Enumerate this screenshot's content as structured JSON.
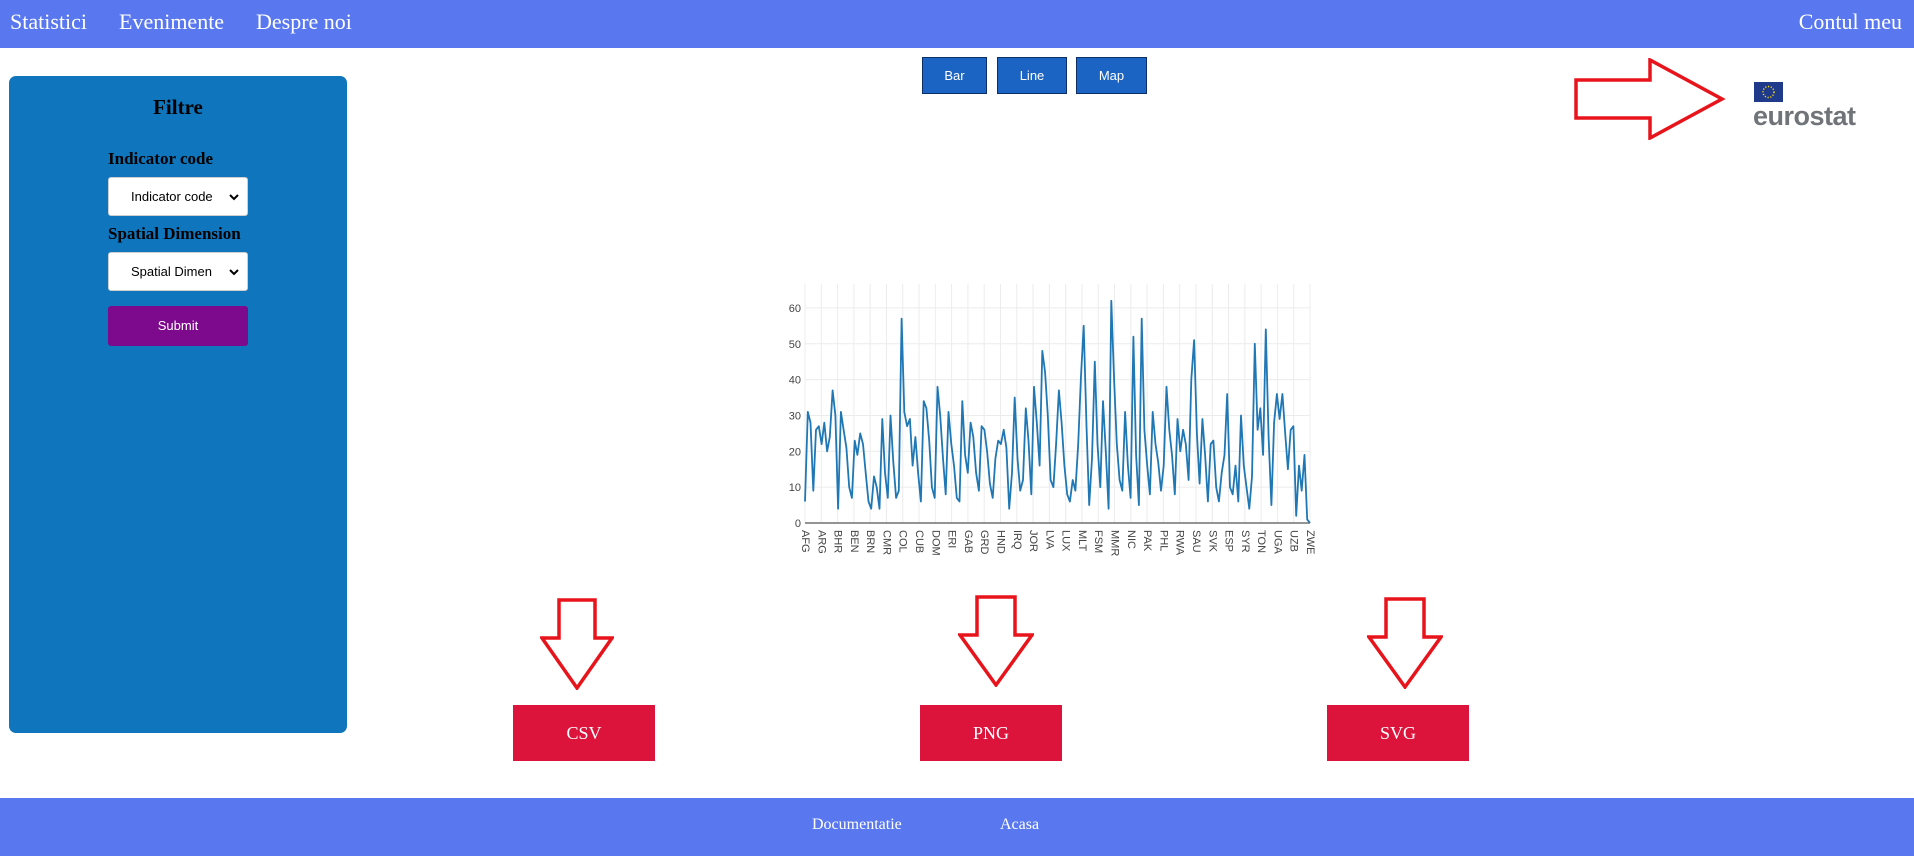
{
  "nav": {
    "left": [
      "Statistici",
      "Evenimente",
      "Despre noi"
    ],
    "right": "Contul meu"
  },
  "sidebar": {
    "title": "Filtre",
    "indicator_label": "Indicator code",
    "indicator_value": "Indicator code",
    "spatial_label": "Spatial Dimension",
    "spatial_value": "Spatial Dimen",
    "submit_label": "Submit"
  },
  "chart_types": [
    "Bar",
    "Line",
    "Map"
  ],
  "logo": {
    "text": "eurostat",
    "flag_color": "#1f3a8a",
    "star_color": "#ffdd00"
  },
  "downloads": [
    "CSV",
    "PNG",
    "SVG"
  ],
  "footer": {
    "links": [
      "Documentatie",
      "Acasa"
    ]
  },
  "colors": {
    "nav": "#5977ee",
    "sidebar": "#0f75bd",
    "submit": "#7d0a8c",
    "chart_button": "#1b64c4",
    "download": "#dc143c",
    "arrow": "#e8141c",
    "line": "#1f77b4"
  },
  "chart_data": {
    "type": "line",
    "ylim": [
      0,
      65
    ],
    "yticks": [
      0,
      10,
      20,
      30,
      40,
      50,
      60
    ],
    "xticks": [
      "AFG",
      "ARG",
      "BHR",
      "BEN",
      "BRN",
      "CMR",
      "COL",
      "CUB",
      "DOM",
      "ERI",
      "GAB",
      "GRD",
      "HND",
      "IRQ",
      "JOR",
      "LVA",
      "LUX",
      "MLT",
      "FSM",
      "MMR",
      "NIC",
      "PAK",
      "PHL",
      "RWA",
      "SAU",
      "SVK",
      "ESP",
      "SYR",
      "TON",
      "UGA",
      "UZB",
      "ZWE"
    ],
    "values": [
      6,
      31,
      28,
      9,
      26,
      27,
      22,
      28,
      20,
      24,
      37,
      30,
      4,
      31,
      26,
      21,
      10,
      7,
      23,
      19,
      25,
      22,
      14,
      6,
      4,
      13,
      10,
      4,
      29,
      14,
      7,
      30,
      17,
      7,
      9,
      57,
      31,
      27,
      29,
      16,
      24,
      14,
      6,
      34,
      32,
      23,
      10,
      7,
      38,
      30,
      18,
      8,
      31,
      22,
      16,
      7,
      6,
      34,
      19,
      14,
      28,
      24,
      14,
      9,
      27,
      26,
      20,
      11,
      7,
      18,
      23,
      22,
      26,
      21,
      4,
      14,
      35,
      18,
      9,
      12,
      32,
      23,
      8,
      38,
      28,
      16,
      48,
      42,
      30,
      12,
      10,
      22,
      37,
      28,
      16,
      8,
      6,
      12,
      9,
      22,
      41,
      55,
      27,
      5,
      18,
      45,
      22,
      10,
      34,
      20,
      4,
      62,
      40,
      22,
      12,
      9,
      31,
      16,
      7,
      52,
      19,
      5,
      57,
      26,
      16,
      8,
      31,
      22,
      17,
      9,
      16,
      38,
      26,
      19,
      8,
      29,
      20,
      26,
      22,
      12,
      40,
      51,
      25,
      11,
      29,
      19,
      6,
      22,
      23,
      10,
      6,
      14,
      19,
      36,
      10,
      8,
      16,
      6,
      30,
      16,
      10,
      4,
      13,
      50,
      26,
      32,
      19,
      54,
      24,
      5,
      28,
      36,
      29,
      36,
      25,
      15,
      26,
      27,
      2,
      16,
      9,
      19,
      1,
      0
    ]
  }
}
